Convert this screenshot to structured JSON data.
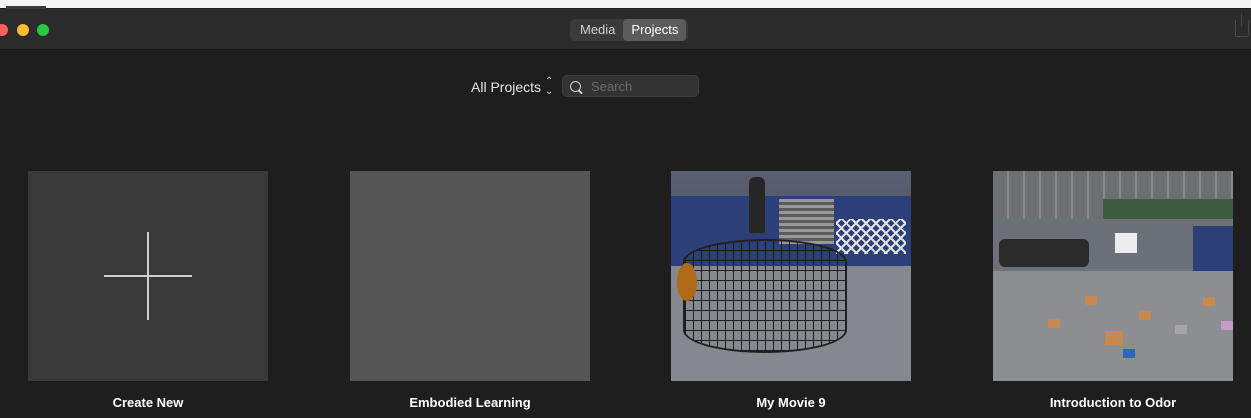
{
  "window": {
    "segments": [
      {
        "label": "Media",
        "active": false
      },
      {
        "label": "Projects",
        "active": true
      }
    ]
  },
  "filter": {
    "scope_label": "All Projects",
    "search_placeholder": "Search",
    "search_value": ""
  },
  "projects": [
    {
      "title": "Create New",
      "thumbnail": "plus-icon"
    },
    {
      "title": "Embodied Learning",
      "thumbnail": "blank"
    },
    {
      "title": "My Movie 9",
      "thumbnail": "gym-cage-photo"
    },
    {
      "title": "Introduction to Odor",
      "thumbnail": "gym-boxes-photo"
    }
  ],
  "colors": {
    "background": "#1e1e1e",
    "titlebar": "#2b2b2b",
    "active_segment": "#5c5c5c",
    "text": "#ffffff"
  }
}
